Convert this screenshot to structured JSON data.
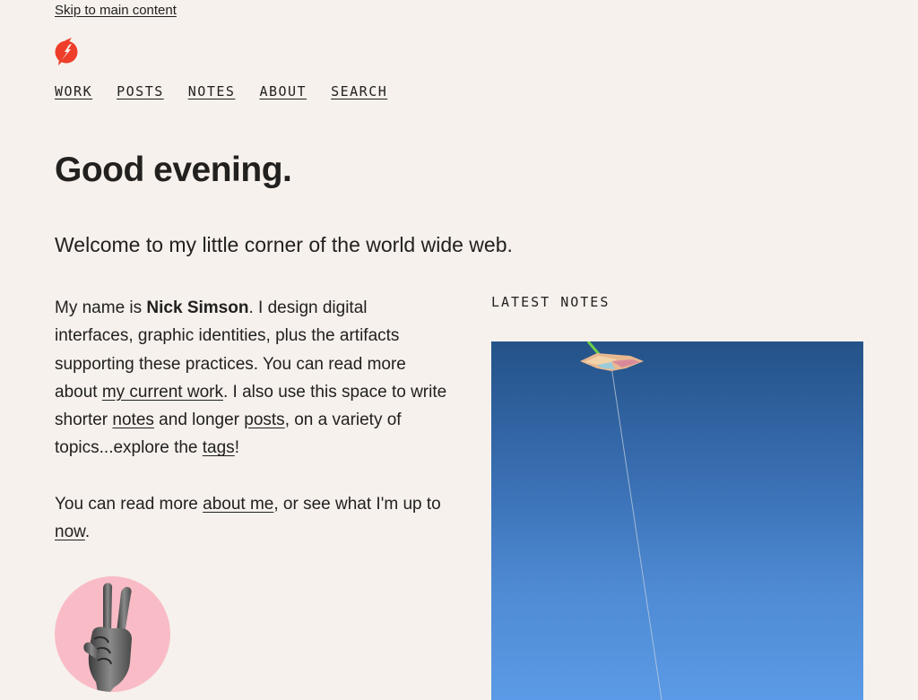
{
  "skip_link": "Skip to main content",
  "logo": {
    "icon": "lightning-bolt-logo-icon",
    "color": "#ee3e2a"
  },
  "nav": {
    "items": [
      {
        "label": "WORK"
      },
      {
        "label": "POSTS"
      },
      {
        "label": "NOTES"
      },
      {
        "label": "ABOUT"
      },
      {
        "label": "SEARCH"
      }
    ]
  },
  "greeting": "Good evening.",
  "welcome": "Welcome to my little corner of the world wide web.",
  "bio": {
    "p1_before_name": "My name is ",
    "name": "Nick Simson",
    "p1_after_name": ". I design digital interfaces, graphic identities, plus the artifacts supporting these practices. You can read more about ",
    "current_work_link": "my current work",
    "p1_after_work": ". I also use this space to write shorter ",
    "notes_link": "notes",
    "p1_and_longer": " and longer ",
    "posts_link": "posts",
    "p1_variety": ", on a variety of topics...explore the ",
    "tags_link": "tags",
    "p1_end": "!",
    "p2_before": "You can read more ",
    "about_me_link": "about me",
    "p2_middle": ", or see what I'm up to ",
    "now_link": "now",
    "p2_end": "."
  },
  "avatar": {
    "icon": "peace-sign-hand-icon",
    "background": "#f9bcc6"
  },
  "latest_notes": {
    "heading": "LATEST NOTES",
    "image_subject": "kite-in-blue-sky"
  },
  "colors": {
    "background": "#f6f1ec",
    "text": "#222120",
    "accent": "#ee3e2a"
  }
}
